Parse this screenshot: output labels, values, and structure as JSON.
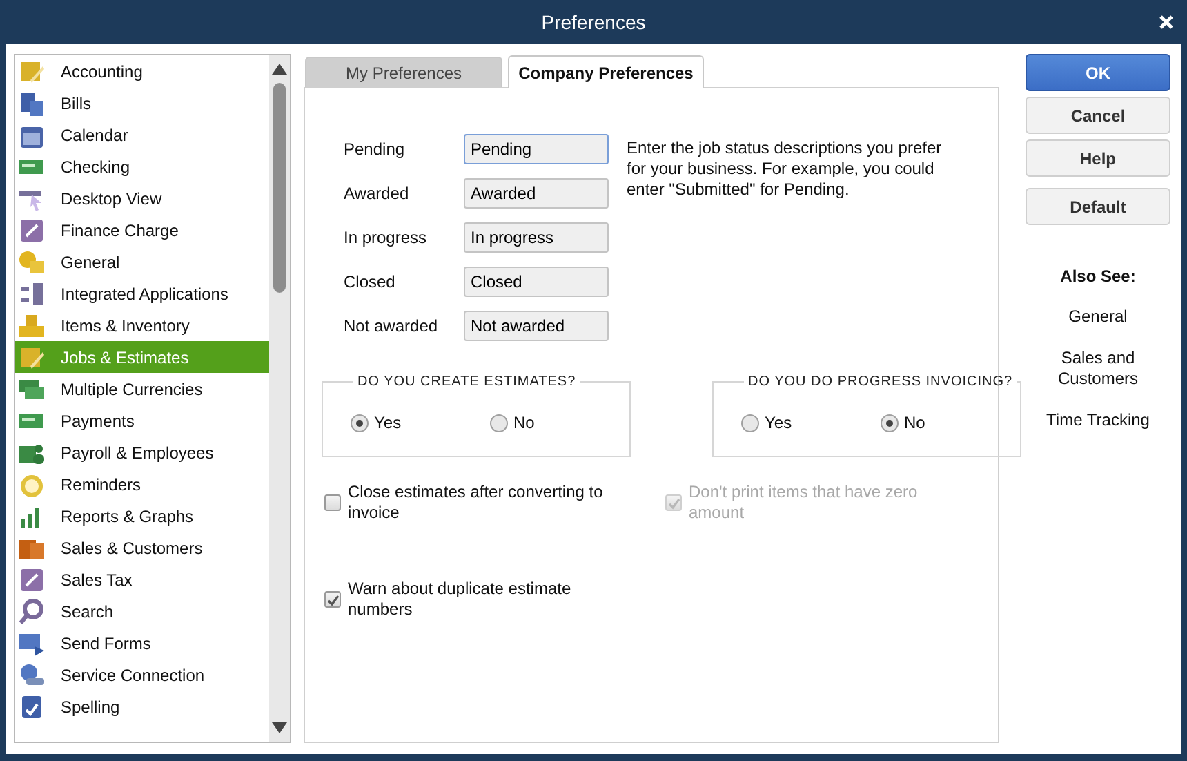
{
  "window": {
    "title": "Preferences"
  },
  "sidebar": {
    "items": [
      {
        "label": "Accounting",
        "selected": false
      },
      {
        "label": "Bills",
        "selected": false
      },
      {
        "label": "Calendar",
        "selected": false
      },
      {
        "label": "Checking",
        "selected": false
      },
      {
        "label": "Desktop View",
        "selected": false
      },
      {
        "label": "Finance Charge",
        "selected": false
      },
      {
        "label": "General",
        "selected": false
      },
      {
        "label": "Integrated Applications",
        "selected": false
      },
      {
        "label": "Items & Inventory",
        "selected": false
      },
      {
        "label": "Jobs & Estimates",
        "selected": true
      },
      {
        "label": "Multiple Currencies",
        "selected": false
      },
      {
        "label": "Payments",
        "selected": false
      },
      {
        "label": "Payroll & Employees",
        "selected": false
      },
      {
        "label": "Reminders",
        "selected": false
      },
      {
        "label": "Reports & Graphs",
        "selected": false
      },
      {
        "label": "Sales & Customers",
        "selected": false
      },
      {
        "label": "Sales Tax",
        "selected": false
      },
      {
        "label": "Search",
        "selected": false
      },
      {
        "label": "Send Forms",
        "selected": false
      },
      {
        "label": "Service Connection",
        "selected": false
      },
      {
        "label": "Spelling",
        "selected": false
      }
    ]
  },
  "tabs": [
    {
      "label": "My Preferences",
      "selected": false
    },
    {
      "label": "Company Preferences",
      "selected": true
    }
  ],
  "status_fields": [
    {
      "label": "Pending",
      "value": "Pending",
      "focused": true
    },
    {
      "label": "Awarded",
      "value": "Awarded",
      "focused": false
    },
    {
      "label": "In progress",
      "value": "In progress",
      "focused": false
    },
    {
      "label": "Closed",
      "value": "Closed",
      "focused": false
    },
    {
      "label": "Not awarded",
      "value": "Not awarded",
      "focused": false
    }
  ],
  "description": "Enter the job status descriptions you prefer for your business.  For example, you could enter \"Submitted\" for Pending.",
  "groups": [
    {
      "title": "DO YOU CREATE ESTIMATES?",
      "options": [
        {
          "label": "Yes",
          "selected": true
        },
        {
          "label": "No",
          "selected": false
        }
      ]
    },
    {
      "title": "DO YOU DO PROGRESS INVOICING?",
      "options": [
        {
          "label": "Yes",
          "selected": false
        },
        {
          "label": "No",
          "selected": true
        }
      ]
    }
  ],
  "checkboxes": [
    {
      "label": "Close estimates after converting to invoice",
      "checked": false,
      "disabled": false
    },
    {
      "label": "Don't print items that have zero amount",
      "checked": true,
      "disabled": true
    },
    {
      "label": "Warn about duplicate estimate numbers",
      "checked": true,
      "disabled": false
    }
  ],
  "buttons": [
    {
      "label": "OK",
      "primary": true
    },
    {
      "label": "Cancel",
      "primary": false
    },
    {
      "label": "Help",
      "primary": false
    },
    {
      "label": "Default",
      "primary": false
    }
  ],
  "also_see": {
    "title": "Also See:",
    "links": [
      "General",
      "Sales and Customers",
      "Time Tracking"
    ]
  }
}
